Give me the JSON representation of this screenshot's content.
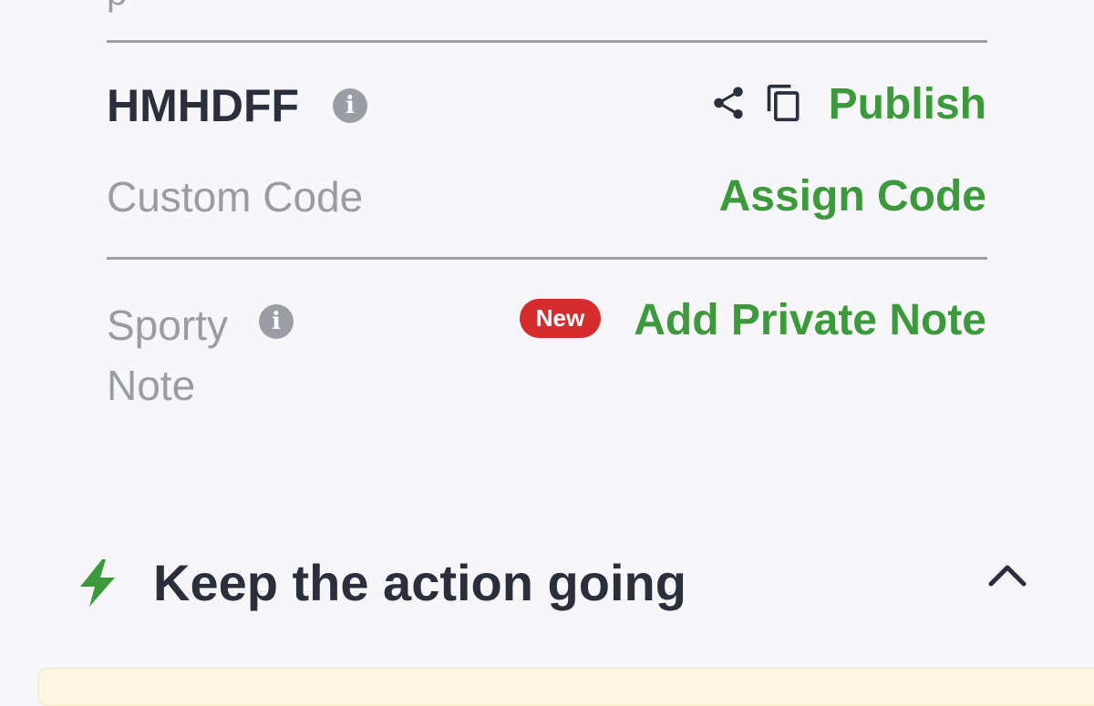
{
  "cutoff_text": "p",
  "booking": {
    "code": "HMHDFF",
    "info_icon": "info-icon",
    "share_icon": "share-icon",
    "copy_icon": "copy-icon",
    "publish_label": "Publish"
  },
  "custom_code": {
    "label": "Custom Code",
    "assign_label": "Assign Code"
  },
  "sporty_note": {
    "label": "Sporty Note",
    "info_icon": "info-icon",
    "badge": "New",
    "add_label": "Add Private Note"
  },
  "section": {
    "icon": "lightning-bolt-icon",
    "title": "Keep the action going",
    "toggle_icon": "chevron-up-icon"
  },
  "colors": {
    "accent_green": "#3d9a3c",
    "badge_red": "#d52d2f",
    "text_dark": "#2b2f3b",
    "text_gray": "#9a9ca4",
    "background": "#f7f7f9",
    "panel_yellow": "#fdf6e0"
  }
}
